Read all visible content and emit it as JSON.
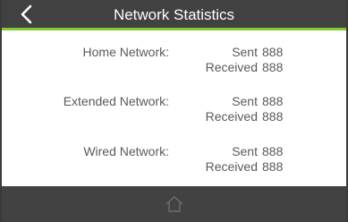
{
  "header": {
    "title": "Network Statistics",
    "back_icon": "chevron-left-icon"
  },
  "networks": [
    {
      "label": "Home Network:",
      "sent_label": "Sent",
      "sent_value": "888",
      "received_label": "Received",
      "received_value": "888"
    },
    {
      "label": "Extended Network:",
      "sent_label": "Sent",
      "sent_value": "888",
      "received_label": "Received",
      "received_value": "888"
    },
    {
      "label": "Wired Network:",
      "sent_label": "Sent",
      "sent_value": "888",
      "received_label": "Received",
      "received_value": "888"
    }
  ],
  "footer": {
    "home_icon": "home-icon"
  },
  "colors": {
    "header_bg": "#414141",
    "accent": "#7ccd2b",
    "footer_bg": "#424242",
    "text": "#5a5a5a"
  }
}
